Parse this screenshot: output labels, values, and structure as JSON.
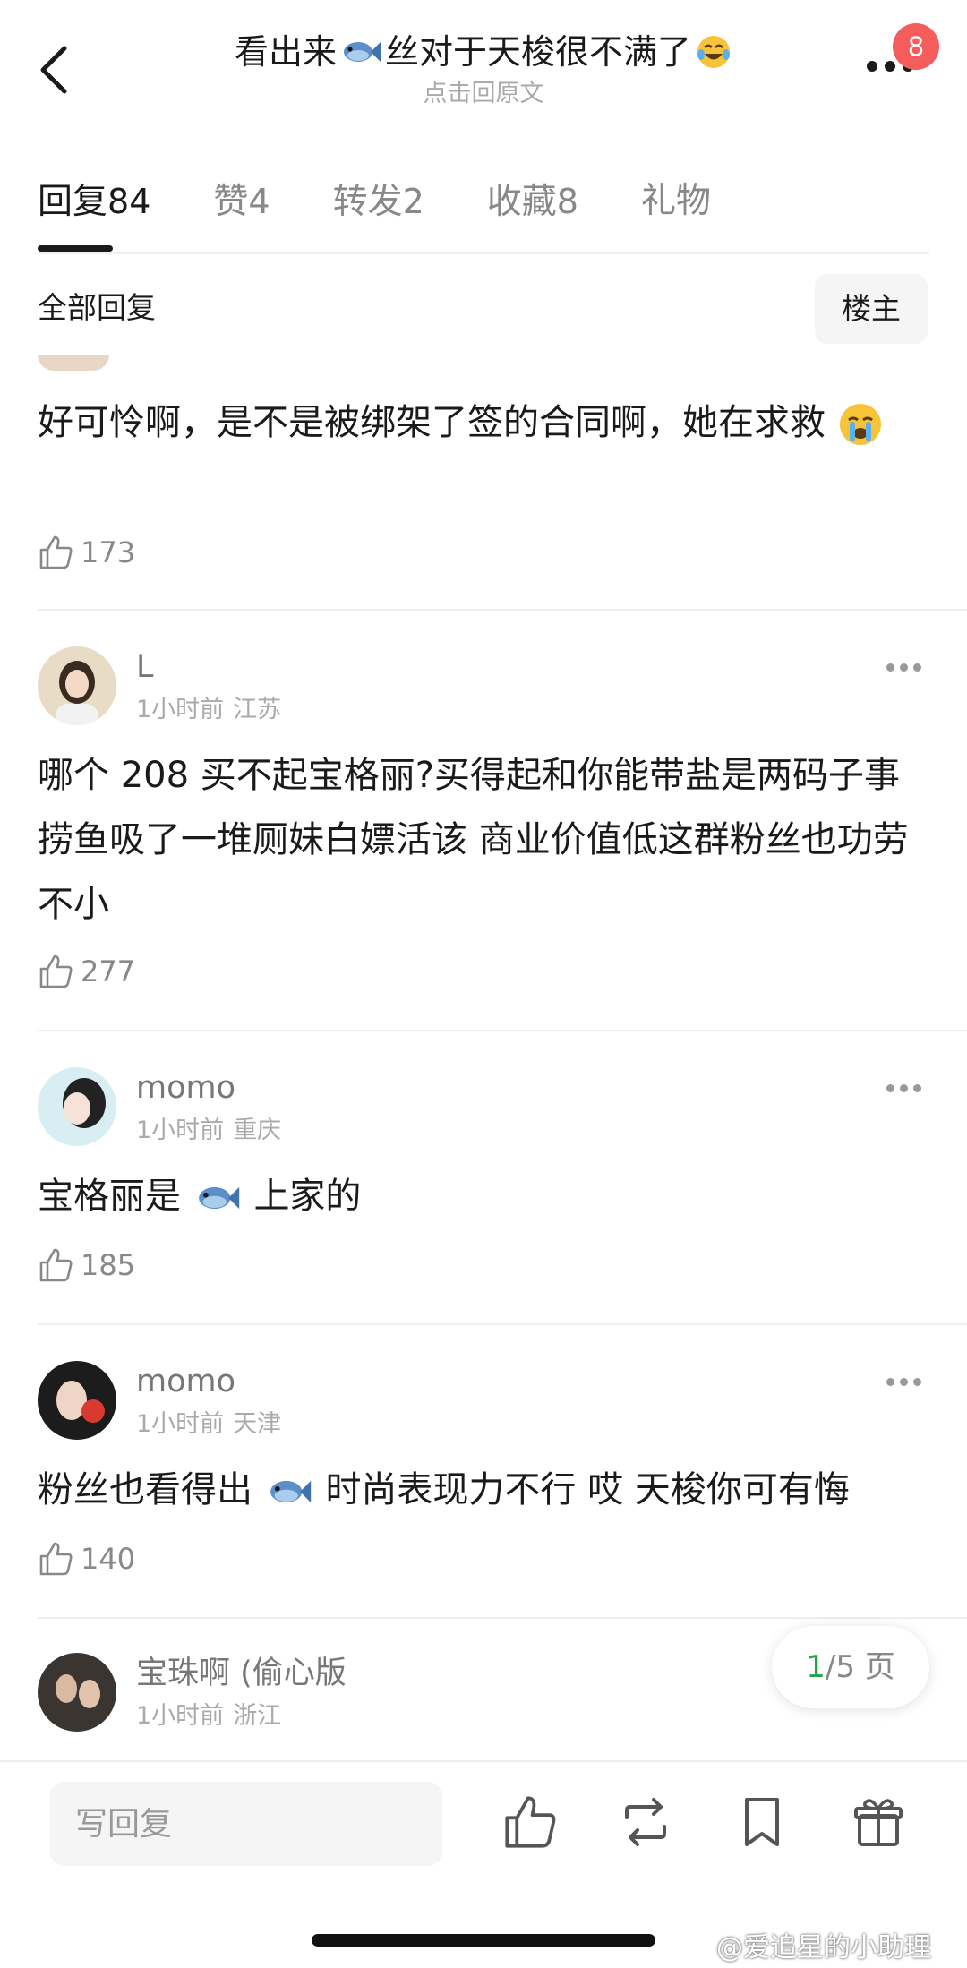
{
  "header": {
    "title_a": "看出来",
    "title_b": "丝对于天梭很不满了",
    "subtitle": "点击回原文",
    "badge_count": "8"
  },
  "tabs": [
    {
      "label": "回复",
      "count": "84"
    },
    {
      "label": "赞",
      "count": "4"
    },
    {
      "label": "转发",
      "count": "2"
    },
    {
      "label": "收藏",
      "count": "8"
    },
    {
      "label": "礼物",
      "count": ""
    }
  ],
  "filter": {
    "label": "全部回复",
    "op_button": "楼主"
  },
  "comments": [
    {
      "text": "好可怜啊，是不是被绑架了签的合同啊，她在求救",
      "likes": "173"
    },
    {
      "username": "L",
      "time": "1小时前",
      "location": "江苏",
      "text": "哪个 208 买不起宝格丽?买得起和你能带盐是两码子事 捞鱼吸了一堆厕妹白嫖活该 商业价值低这群粉丝也功劳不小",
      "likes": "277"
    },
    {
      "username": "momo",
      "time": "1小时前",
      "location": "重庆",
      "text_a": "宝格丽是",
      "text_b": "上家的",
      "likes": "185"
    },
    {
      "username": "momo",
      "time": "1小时前",
      "location": "天津",
      "text_a": "粉丝也看得出",
      "text_b": "时尚表现力不行 哎 天梭你可有悔",
      "likes": "140"
    },
    {
      "username": "宝珠啊 (偷心版",
      "time": "1小时前",
      "location": "浙江"
    }
  ],
  "pagination": {
    "current": "1",
    "total": "/5 页"
  },
  "bottom_bar": {
    "reply_placeholder": "写回复"
  },
  "watermark": "@爱追星的小助理",
  "colors": {
    "accent_green": "#22a447",
    "badge_red": "#f55d5d"
  }
}
